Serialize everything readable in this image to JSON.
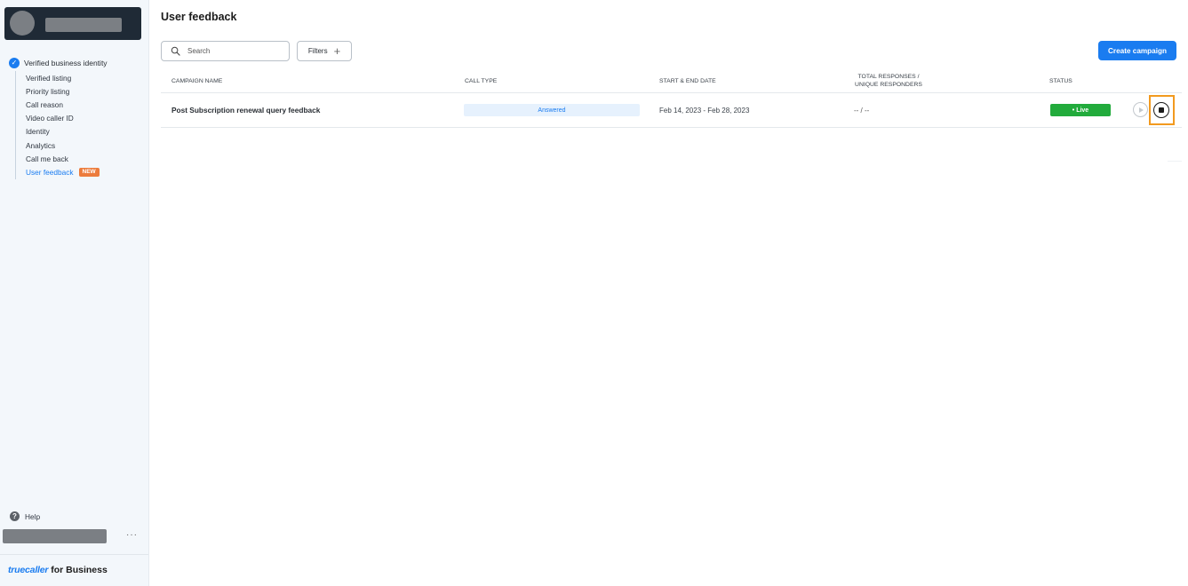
{
  "sidebar": {
    "section_title": "Verified business identity",
    "items": [
      {
        "label": "Verified listing"
      },
      {
        "label": "Priority listing"
      },
      {
        "label": "Call reason"
      },
      {
        "label": "Video caller ID"
      },
      {
        "label": "Identity"
      },
      {
        "label": "Analytics"
      },
      {
        "label": "Call me back"
      },
      {
        "label": "User feedback",
        "badge": "NEW",
        "active": true
      }
    ],
    "help_label": "Help",
    "more_label": "···",
    "brand_truecaller": "truecaller",
    "brand_suffix": " for Business"
  },
  "main": {
    "title": "User feedback",
    "search": {
      "placeholder": "Search",
      "value": ""
    },
    "filters_label": "Filters",
    "create_label": "Create campaign",
    "columns": {
      "campaign_name": "CAMPAIGN NAME",
      "call_type": "CALL TYPE",
      "dates": "START & END DATE",
      "responses_line1": "TOTAL RESPONSES /",
      "responses_line2": "UNIQUE RESPONDERS",
      "status": "STATUS"
    },
    "rows": [
      {
        "campaign_name": "Post Subscription renewal query feedback",
        "call_type": "Answered",
        "dates": "Feb 14, 2023 - Feb 28, 2023",
        "responses": "-- / --",
        "status": "• Live"
      }
    ]
  },
  "colors": {
    "accent": "#1a7cf0",
    "live": "#22ab3c",
    "new_badge": "#ec7c3c",
    "highlight": "#f29a1f"
  }
}
